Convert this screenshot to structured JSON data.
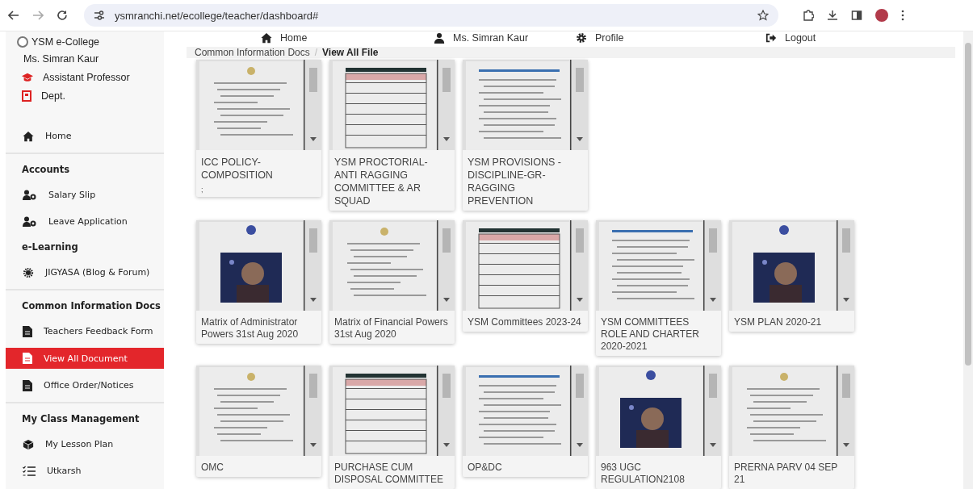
{
  "browser": {
    "url": "ysmranchi.net/ecollege/teacher/dashboard#"
  },
  "sidebar": {
    "brand": "YSM e-College",
    "user": "Ms. Simran Kaur",
    "designation": "Assistant Professor",
    "department": "Dept.",
    "groups": [
      {
        "entries": [
          {
            "kind": "link",
            "label": "Home",
            "selected": false
          }
        ]
      },
      {
        "entries": [
          {
            "kind": "heading",
            "label": "Accounts"
          },
          {
            "kind": "link",
            "label": "Salary Slip",
            "selected": false
          },
          {
            "kind": "link",
            "label": "Leave Application",
            "selected": false
          },
          {
            "kind": "heading",
            "label": "e-Learning"
          },
          {
            "kind": "link",
            "label": "JIGYASA (Blog & Forum)",
            "selected": false
          }
        ]
      },
      {
        "entries": [
          {
            "kind": "heading",
            "label": "Common Information Docs"
          },
          {
            "kind": "link",
            "label": "Teachers Feedback Form",
            "selected": false
          },
          {
            "kind": "link",
            "label": "View All Document",
            "selected": true
          },
          {
            "kind": "link",
            "label": "Office Order/Notices",
            "selected": false
          }
        ]
      },
      {
        "entries": [
          {
            "kind": "heading",
            "label": "My Class Management"
          },
          {
            "kind": "link",
            "label": "My Lesson Plan",
            "selected": false
          },
          {
            "kind": "link",
            "label": "Utkarsh",
            "selected": false
          }
        ]
      }
    ]
  },
  "topnav": [
    {
      "label": "Home"
    },
    {
      "label": "Ms. Simran Kaur"
    },
    {
      "label": "Profile"
    },
    {
      "label": "Logout"
    }
  ],
  "breadcrumb": {
    "separator": "/",
    "items": [
      "Common Information Docs",
      "View All File"
    ]
  },
  "document_rows": [
    {
      "documents": [
        {
          "title": "ICC POLICY-COMPOSITION",
          "note": ";"
        },
        {
          "title": "YSM PROCTORIAL-ANTI RAGGING COMMITTEE & AR SQUAD"
        },
        {
          "title": "YSM PROVISIONS - DISCIPLINE-GR- RAGGING PREVENTION"
        }
      ]
    },
    {
      "documents": [
        {
          "title": "Matrix of Administrator Powers 31st Aug 2020"
        },
        {
          "title": "Matrix of Financial Powers 31st Aug 2020"
        },
        {
          "title": "YSM Committees 2023-24"
        },
        {
          "title": "YSM COMMITTEES ROLE AND CHARTER 2020-2021"
        },
        {
          "title": "YSM PLAN 2020-21"
        }
      ]
    },
    {
      "documents": [
        {
          "title": "OMC"
        },
        {
          "title": "PURCHASE CUM DISPOSAL COMMITTEE"
        },
        {
          "title": "OP&DC"
        },
        {
          "title": "963 UGC REGULATION2108"
        },
        {
          "title": "PRERNA PARV 04 SEP 21"
        }
      ]
    }
  ]
}
